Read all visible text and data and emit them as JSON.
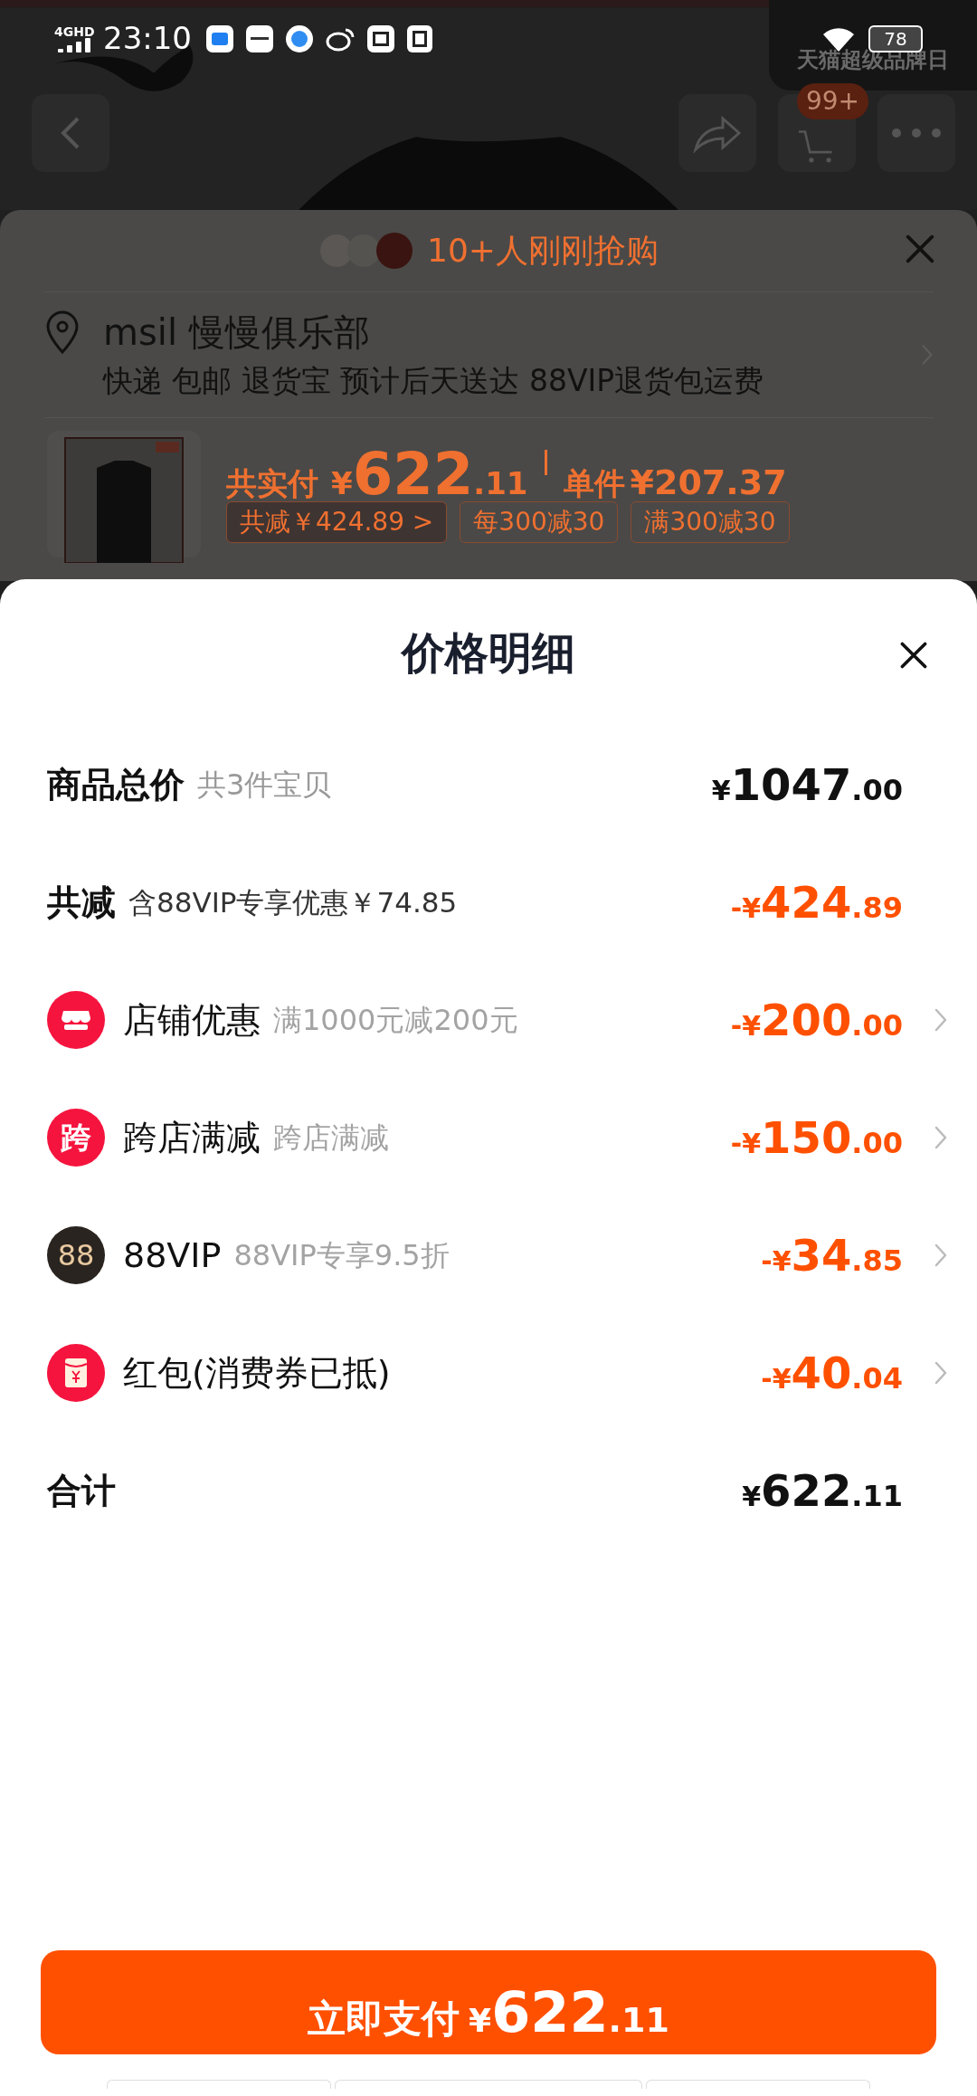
{
  "status_bar": {
    "network": "4GHD",
    "time": "23:10",
    "battery": "78"
  },
  "background_page": {
    "banner": "天猫超级品牌日",
    "cart_badge": "99+"
  },
  "order_sheet": {
    "buyers": "10+人刚刚抢购",
    "address_name": "msil 慢慢俱乐部",
    "delivery": "快递 包邮 退货宝 预计后天送达 88VIP退货包运费",
    "total_label": "共实付",
    "total_currency": "¥",
    "total_main": "622",
    "total_fraction": ".11",
    "unit_label": "单件",
    "unit_price": "¥207.37",
    "tags": [
      "共减￥424.89 >",
      "每300减30",
      "满300减30"
    ]
  },
  "price_detail": {
    "title": "价格明细",
    "rows": [
      {
        "kind": "summary",
        "label": "商品总价",
        "note": "共3件宝贝",
        "emphasis": false,
        "amount": {
          "prefix": "¥",
          "main": "1047",
          "fraction": ".00"
        }
      },
      {
        "kind": "summary",
        "label": "共减",
        "note": "含88VIP专享优惠￥74.85",
        "emphasis": true,
        "amount": {
          "prefix": "-¥",
          "main": "424",
          "fraction": ".89"
        }
      },
      {
        "kind": "discount",
        "label": "店铺优惠",
        "note": "满1000元减200元",
        "emphasis": true,
        "amount": {
          "prefix": "-¥",
          "main": "200",
          "fraction": ".00"
        }
      },
      {
        "kind": "discount",
        "icon_text": "跨",
        "label": "跨店满减",
        "note": "跨店满减",
        "emphasis": true,
        "amount": {
          "prefix": "-¥",
          "main": "150",
          "fraction": ".00"
        }
      },
      {
        "kind": "discount",
        "icon_text": "88",
        "label": "88VIP",
        "note": "88VIP专享9.5折",
        "emphasis": true,
        "amount": {
          "prefix": "-¥",
          "main": "34",
          "fraction": ".85"
        }
      },
      {
        "kind": "discount",
        "label": "红包(消费券已抵)",
        "emphasis": true,
        "amount": {
          "prefix": "-¥",
          "main": "40",
          "fraction": ".04"
        }
      },
      {
        "kind": "total",
        "label": "合计",
        "emphasis": false,
        "amount": {
          "prefix": "¥",
          "main": "622",
          "fraction": ".11"
        }
      }
    ]
  },
  "pay_button": {
    "label": "立即支付",
    "currency": "¥",
    "main": "622",
    "fraction": ".11"
  }
}
